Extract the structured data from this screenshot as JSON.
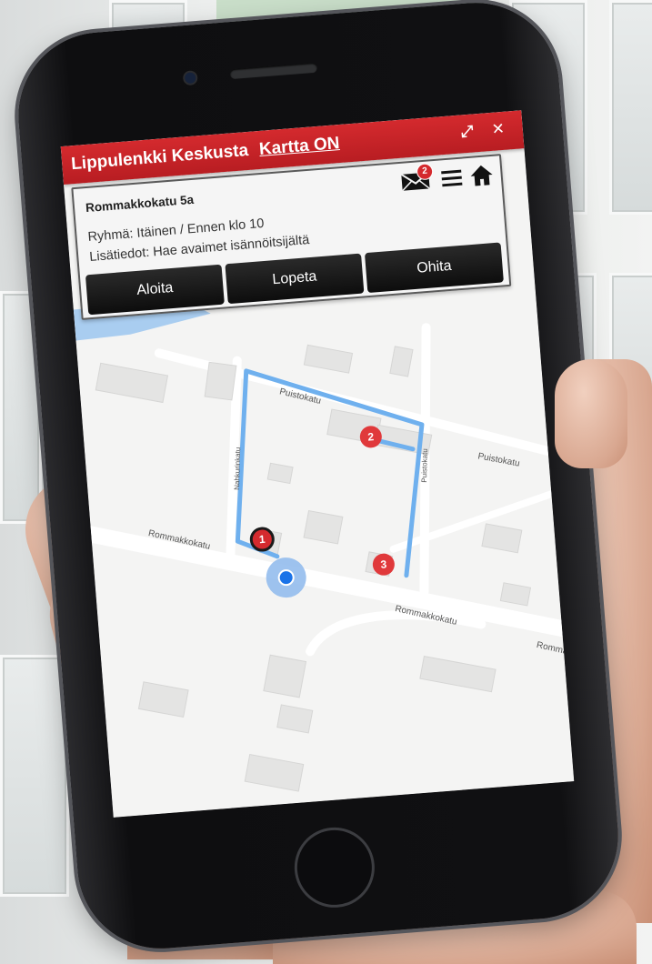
{
  "app": {
    "title": "Lippulenkki Keskusta",
    "map_toggle": "Kartta ON"
  },
  "header_icons": [
    "expand-icon",
    "close-icon"
  ],
  "task": {
    "address": "Rommakkokatu 5a",
    "group": "Ryhmä: Itäinen / Ennen klo 10",
    "extra_info": "Lisätiedot: Hae avaimet isännöitsijältä",
    "messages_count": "2"
  },
  "actions": {
    "start": "Aloita",
    "stop": "Lopeta",
    "skip": "Ohita"
  },
  "map": {
    "streets": {
      "puistokatu_a": "Puistokatu",
      "puistokatu_b": "Puistokatu",
      "rommakkokatu_a": "Rommakkokatu",
      "rommakkokatu_b": "Rommakkokatu",
      "rommakkokatu_c": "Rommakkokatu",
      "nahkurinkatu": "Nahkurinkatu",
      "side_street": "Puistokatu"
    },
    "markers": [
      {
        "label": "1",
        "color": "#1a1a1a"
      },
      {
        "label": "2",
        "color": "#e0393b"
      },
      {
        "label": "3",
        "color": "#e0393b"
      }
    ],
    "colors": {
      "route": "#6fb0ee",
      "user_location": "#1a73e8",
      "water": "#a9cdf0"
    }
  },
  "colors": {
    "header_red": "#c4232a",
    "button_dark": "#111111"
  }
}
